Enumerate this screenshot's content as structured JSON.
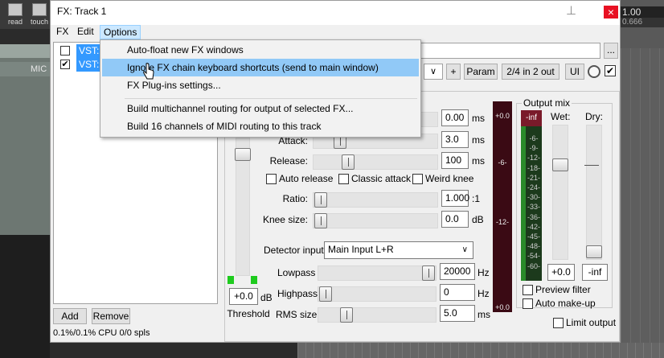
{
  "daw": {
    "toolbar": [
      {
        "label": "read"
      },
      {
        "label": "touch"
      }
    ],
    "track_label": "MIC",
    "timecode": "1.00",
    "timecode_sub": "0.666"
  },
  "window": {
    "title": "FX: Track 1",
    "close_symbol": "×",
    "pin_symbol": "⊥"
  },
  "menubar": {
    "fx": "FX",
    "edit": "Edit",
    "options": "Options"
  },
  "fx_list": [
    {
      "name": "VST: a",
      "checked": false
    },
    {
      "name": "VST: F",
      "checked": true
    }
  ],
  "buttons": {
    "add": "Add",
    "remove": "Remove",
    "preset_menu": "...",
    "preset_dropdown": "∨",
    "plus": "+",
    "param": "Param",
    "io": "2/4 in 2 out",
    "ui": "UI"
  },
  "status": {
    "cpu": "0.1%/0.1% CPU 0/0 spls"
  },
  "options_menu": {
    "items": [
      "Auto-float new FX windows",
      "Ignore FX chain keyboard shortcuts (send to main window)",
      "FX Plug-ins settings...",
      "Build multichannel routing for output of selected FX...",
      "Build 16 channels of MIDI routing to this track"
    ],
    "highlighted_index": 1
  },
  "compressor": {
    "pre_comp": {
      "value": "0.00",
      "unit": "ms"
    },
    "attack": {
      "label": "Attack:",
      "value": "3.0",
      "unit": "ms"
    },
    "release": {
      "label": "Release:",
      "value": "100",
      "unit": "ms"
    },
    "auto_release": "Auto release",
    "classic_attack": "Classic attack",
    "weird_knee": "Weird knee",
    "ratio": {
      "label": "Ratio:",
      "value": "1.000",
      "unit": ":1"
    },
    "knee": {
      "label": "Knee size:",
      "value": "0.0",
      "unit": "dB"
    },
    "detector_label": "Detector input:",
    "detector_value": "Main Input L+R",
    "lowpass": {
      "label": "Lowpass",
      "value": "20000",
      "unit": "Hz"
    },
    "highpass": {
      "label": "Highpass",
      "value": "0",
      "unit": "Hz"
    },
    "rms": {
      "label": "RMS size",
      "value": "5.0",
      "unit": "ms"
    },
    "threshold": {
      "label": "Threshold",
      "value": "+0.0",
      "unit": "dB"
    }
  },
  "meter": {
    "ticks": [
      "+0.0",
      "-6-",
      "-12-",
      "+0.0"
    ]
  },
  "output_mix": {
    "title": "Output mix",
    "wet_label": "Wet:",
    "dry_label": "Dry:",
    "meter_top": "-inf",
    "ticks": [
      "-6-",
      "-9-",
      "-12-",
      "-18-",
      "-21-",
      "-24-",
      "-30-",
      "-33-",
      "-36-",
      "-42-",
      "-45-",
      "-48-",
      "-54-",
      "-60-"
    ],
    "wet_value": "+0.0",
    "dry_value": "-inf",
    "preview_filter": "Preview filter",
    "auto_makeup": "Auto make-up",
    "limit_output": "Limit output"
  },
  "colors": {
    "menu_highlight": "#91c9f7",
    "selection": "#3399ff",
    "close": "#e81123",
    "meter_green": "#1ecb1e"
  }
}
